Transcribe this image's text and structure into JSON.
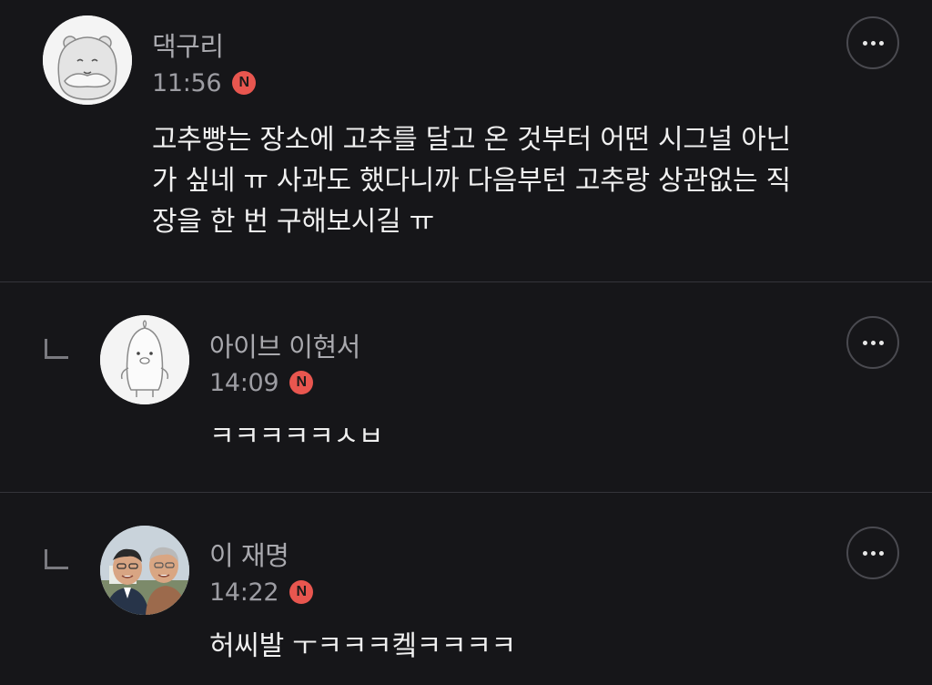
{
  "comments": [
    {
      "author": "댁구리",
      "time": "11:56",
      "badge": "N",
      "avatar_icon": "bear-face-icon",
      "body": "고추빵는 장소에 고추를 달고 온 것부터 어떤 시그널 아닌\n가 싶네 ㅠ 사과도 했다니까 다음부턴 고추랑 상관없는 직\n장을 한 번 구해보시길 ㅠ"
    },
    {
      "author": "아이브 이현서",
      "time": "14:09",
      "badge": "N",
      "avatar_icon": "penguin-character-icon",
      "body": "ㅋㅋㅋㅋㅋㅅㅂ"
    },
    {
      "author": "이 재명",
      "time": "14:22",
      "badge": "N",
      "avatar_icon": "profile-photo",
      "body": "허씨발 ㅜㅋㅋㅋ켘ㅋㅋㅋㅋ"
    }
  ],
  "colors": {
    "background": "#161619",
    "badge": "#e8564f",
    "author": "#a9a9ae",
    "body_text": "#f0f0f0",
    "divider": "#34343a"
  },
  "icons": {
    "more": "more-dots-icon",
    "reply": "reply-arrow-icon",
    "new": "new-badge"
  }
}
